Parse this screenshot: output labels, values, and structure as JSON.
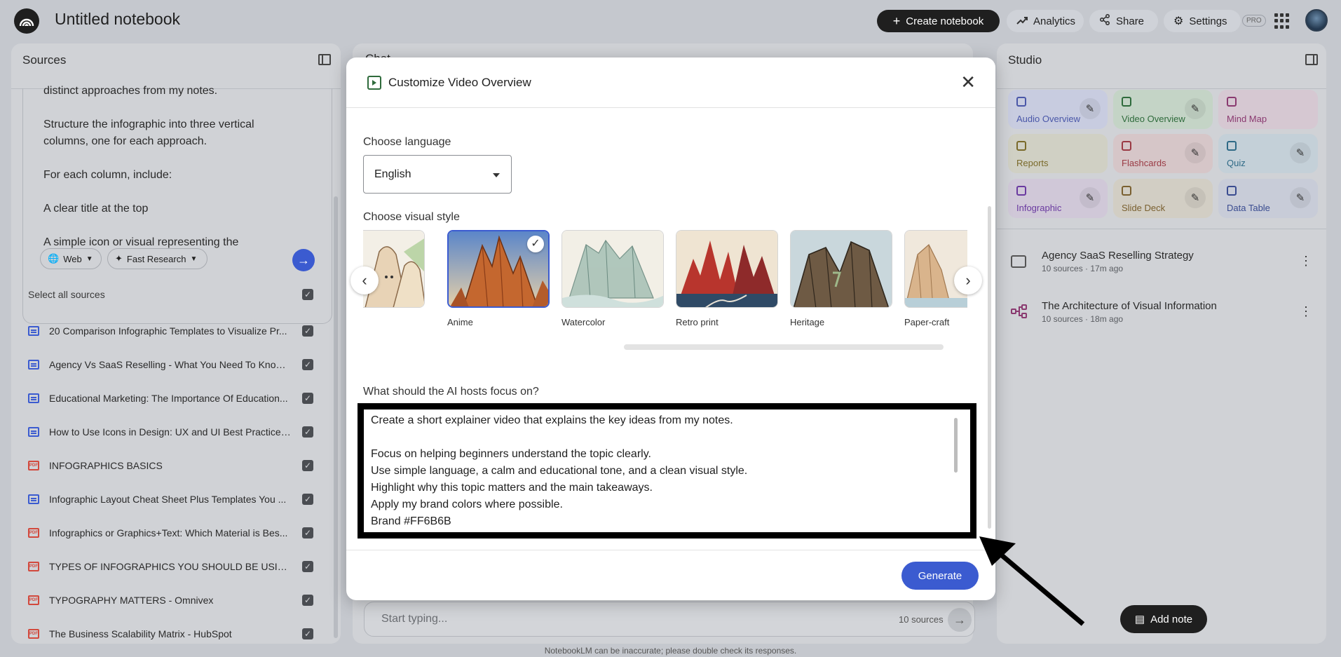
{
  "header": {
    "title": "Untitled notebook",
    "create_label": "Create notebook",
    "analytics_label": "Analytics",
    "share_label": "Share",
    "settings_label": "Settings",
    "pro_badge": "PRO"
  },
  "sources": {
    "title": "Sources",
    "query_paragraphs": [
      "distinct approaches from my notes.",
      "Structure the infographic into three vertical columns, one for each approach.",
      "For each column, include:",
      "A clear title at the top",
      "A simple icon or visual representing the"
    ],
    "web_chip": "Web",
    "research_chip": "Fast Research",
    "select_all_label": "Select all sources",
    "items": [
      {
        "label": "20 Comparison Infographic Templates to Visualize Pr...",
        "type": "doc"
      },
      {
        "label": "Agency Vs SaaS Reselling - What You Need To Know :...",
        "type": "doc"
      },
      {
        "label": "Educational Marketing: The Importance Of Education...",
        "type": "doc"
      },
      {
        "label": "How to Use Icons in Design: UX and UI Best Practices...",
        "type": "doc"
      },
      {
        "label": "INFOGRAPHICS BASICS",
        "type": "pdf"
      },
      {
        "label": "Infographic Layout Cheat Sheet Plus Templates You ...",
        "type": "doc"
      },
      {
        "label": "Infographics or Graphics+Text: Which Material is Bes...",
        "type": "pdf"
      },
      {
        "label": "TYPES OF INFOGRAPHICS YOU SHOULD BE USING I...",
        "type": "pdf"
      },
      {
        "label": "TYPOGRAPHY MATTERS - Omnivex",
        "type": "pdf"
      },
      {
        "label": "The Business Scalability Matrix - HubSpot",
        "type": "pdf"
      }
    ]
  },
  "chat": {
    "title": "Chat",
    "input_placeholder": "Start typing...",
    "source_count": "10 sources",
    "disclaimer": "NotebookLM can be inaccurate; please double check its responses."
  },
  "studio": {
    "title": "Studio",
    "tiles": {
      "audio": "Audio Overview",
      "video": "Video Overview",
      "mind_map": "Mind Map",
      "reports": "Reports",
      "flashcards": "Flashcards",
      "quiz": "Quiz",
      "infographic": "Infographic",
      "slide_deck": "Slide Deck",
      "data_table": "Data Table"
    },
    "notes": [
      {
        "title": "Agency SaaS Reselling Strategy",
        "meta": "10 sources · 17m ago"
      },
      {
        "title": "The Architecture of Visual Information",
        "meta": "10 sources · 18m ago"
      }
    ],
    "add_note_label": "Add note"
  },
  "modal": {
    "title": "Customize Video Overview",
    "language_label": "Choose language",
    "language_value": "English",
    "style_label": "Choose visual style",
    "styles": [
      {
        "name": ""
      },
      {
        "name": "Anime"
      },
      {
        "name": "Watercolor"
      },
      {
        "name": "Retro print"
      },
      {
        "name": "Heritage"
      },
      {
        "name": "Paper-craft"
      }
    ],
    "selected_style": "Anime",
    "focus_label": "What should the AI hosts focus on?",
    "focus_text": "Create a short explainer video that explains the key ideas from my notes.\n\nFocus on helping beginners understand the topic clearly.\nUse simple language, a calm and educational tone, and a clean visual style.\nHighlight why this topic matters and the main takeaways.\nApply my brand colors where possible.\nBrand #FF6B6B",
    "generate_label": "Generate"
  },
  "colors": {
    "accent": "#3b5bd0",
    "dark_button": "#1f1f1f",
    "highlight_border": "#000000"
  }
}
